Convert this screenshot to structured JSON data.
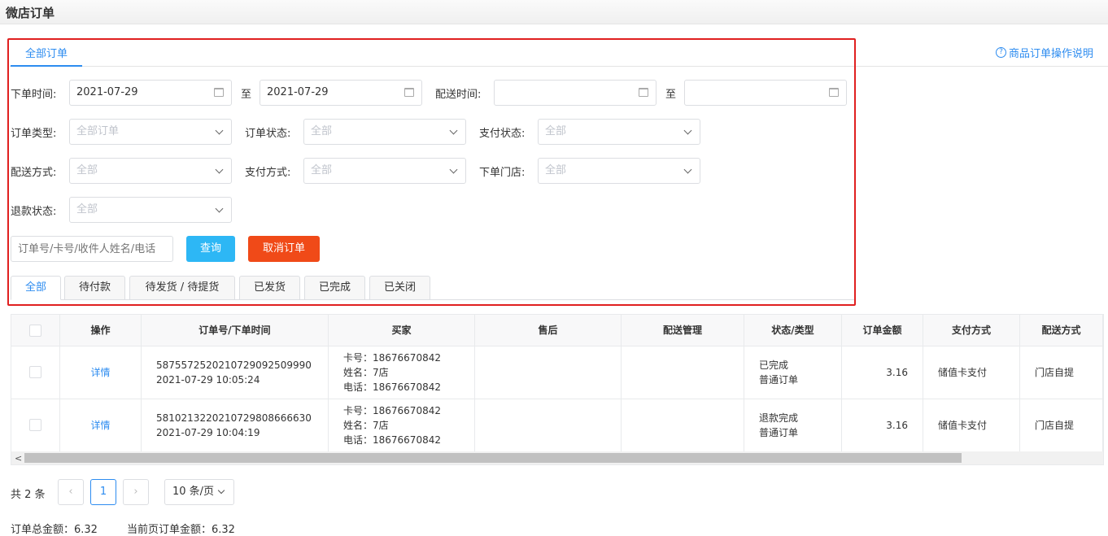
{
  "header": {
    "title": "微店订单"
  },
  "help": {
    "icon": "?",
    "label": "商品订单操作说明"
  },
  "top_tab": "全部订单",
  "filters": {
    "order_time_label": "下单时间:",
    "order_time_from": "2021-07-29",
    "to1": "至",
    "order_time_to": "2021-07-29",
    "delivery_time_label": "配送时间:",
    "to2": "至",
    "order_type_label": "订单类型:",
    "order_type_value": "全部订单",
    "order_status_label": "订单状态:",
    "order_status_value": "全部",
    "pay_status_label": "支付状态:",
    "pay_status_value": "全部",
    "delivery_method_label": "配送方式:",
    "delivery_method_value": "全部",
    "pay_method_label": "支付方式:",
    "pay_method_value": "全部",
    "store_label": "下单门店:",
    "store_value": "全部",
    "refund_label": "退款状态:",
    "refund_value": "全部",
    "search_placeholder": "订单号/卡号/收件人姓名/电话",
    "query_btn": "查询",
    "cancel_btn": "取消订单"
  },
  "status_tabs": [
    "全部",
    "待付款",
    "待发货 / 待提货",
    "已发货",
    "已完成",
    "已关闭"
  ],
  "table": {
    "headers": [
      "操作",
      "订单号/下单时间",
      "买家",
      "售后",
      "配送管理",
      "状态/类型",
      "订单金额",
      "支付方式",
      "配送方式"
    ],
    "rows": [
      {
        "action": "详情",
        "order_no": "5875572520210729092509990",
        "time": "2021-07-29 10:05:24",
        "card": "卡号：18676670842",
        "name": "姓名：7店",
        "phone": "电话：18676670842",
        "status": "已完成",
        "type": "普通订单",
        "amount": "3.16",
        "pay": "储值卡支付",
        "delivery": "门店自提"
      },
      {
        "action": "详情",
        "order_no": "5810213220210729808666630",
        "time": "2021-07-29 10:04:19",
        "card": "卡号：18676670842",
        "name": "姓名：7店",
        "phone": "电话：18676670842",
        "status": "退款完成",
        "type": "普通订单",
        "amount": "3.16",
        "pay": "储值卡支付",
        "delivery": "门店自提"
      }
    ]
  },
  "pager": {
    "total": "共 2 条",
    "prev": "‹",
    "page": "1",
    "next": "›",
    "size": "10 条/页"
  },
  "totals": {
    "total_label": "订单总金额：6.32",
    "page_label": "当前页订单金额：6.32"
  },
  "colors": {
    "accent": "#2d8cf0",
    "query": "#2db7f5",
    "cancel": "#f04a18",
    "redbox": "#e02020"
  }
}
